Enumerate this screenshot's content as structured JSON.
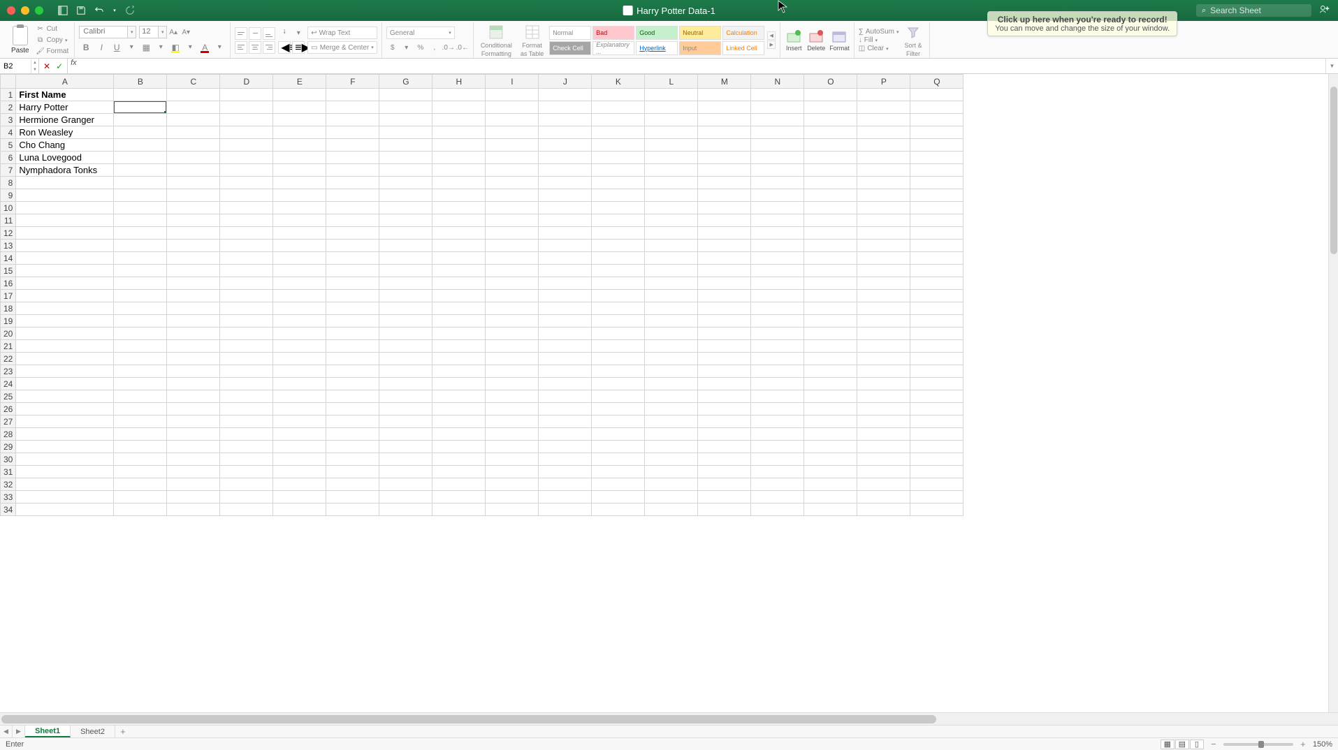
{
  "window": {
    "title": "Harry Potter Data-1"
  },
  "search": {
    "placeholder": "Search Sheet"
  },
  "overlay": {
    "title": "Click up here when you're ready to record!",
    "sub": "You can move and change the size of your window."
  },
  "ribbon": {
    "paste": "Paste",
    "cut": "Cut",
    "copy": "Copy",
    "format_painter": "Format",
    "font_name": "Calibri",
    "font_size": "12",
    "wrap_text": "Wrap Text",
    "merge_center": "Merge & Center",
    "number_format": "General",
    "cond_fmt_1": "Conditional",
    "cond_fmt_2": "Formatting",
    "fmt_table_1": "Format",
    "fmt_table_2": "as Table",
    "style_normal": "Normal",
    "style_bad": "Bad",
    "style_good": "Good",
    "style_neutral": "Neutral",
    "style_calc": "Calculation",
    "style_check": "Check Cell",
    "style_expl": "Explanatory ...",
    "style_hyper": "Hyperlink",
    "style_input": "Input",
    "style_linked": "Linked Cell",
    "insert": "Insert",
    "delete": "Delete",
    "format": "Format",
    "autosum": "AutoSum",
    "fill": "Fill",
    "clear": "Clear",
    "sort_filter_1": "Sort &",
    "sort_filter_2": "Filter"
  },
  "name_box": "B2",
  "columns": [
    "A",
    "B",
    "C",
    "D",
    "E",
    "F",
    "G",
    "H",
    "I",
    "J",
    "K",
    "L",
    "M",
    "N",
    "O",
    "P",
    "Q"
  ],
  "rows": 34,
  "cells": {
    "A1": "First Name",
    "A2": "Harry Potter",
    "A3": "Hermione Granger",
    "A4": "Ron Weasley",
    "A5": "Cho Chang",
    "A6": "Luna Lovegood",
    "A7": "Nymphadora Tonks"
  },
  "selected_cell": "B2",
  "sheets": {
    "items": [
      "Sheet1",
      "Sheet2"
    ],
    "active": 0
  },
  "status": {
    "mode": "Enter",
    "zoom": "150%"
  }
}
